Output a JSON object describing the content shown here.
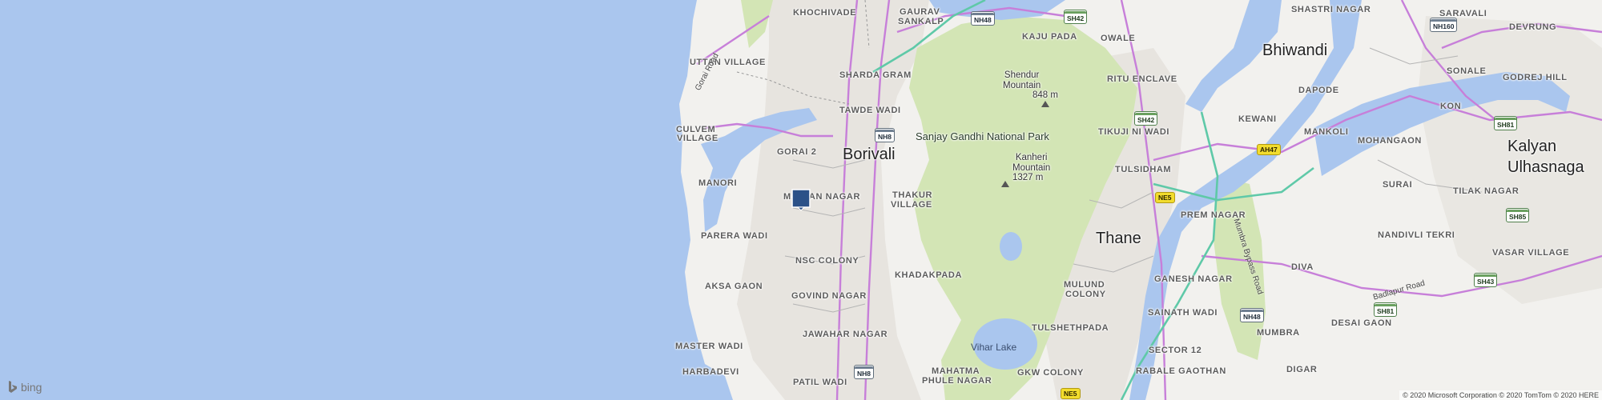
{
  "map": {
    "attribution": "© 2020 Microsoft Corporation © 2020 TomTom © 2020 HERE",
    "logo_text": "bing",
    "colors": {
      "water": "#aac6ee",
      "land": "#f2f1ee",
      "urban": "#e6e4df",
      "park": "#d3e5b5",
      "primary_road": "#c77fd9",
      "highway": "#5fc9a8"
    },
    "cities": {
      "borivali": "Borivali",
      "thane": "Thane",
      "bhiwandi": "Bhiwandi",
      "kalyan": "Kalyan",
      "ulhasnagar": "Ulhasnaga"
    },
    "park": "Sanjay Gandhi National Park",
    "peaks": {
      "shendur_name": "Shendur\nMountain",
      "shendur_elev": "848 m",
      "kanheri_name": "Kanheri\nMountain",
      "kanheri_elev": "1327 m"
    },
    "water_body": "Vihar Lake",
    "neighborhoods": {
      "khochivade": "KHOCHIVADE",
      "gaurav_sankalp_1": "GAURAV",
      "gaurav_sankalp_2": "SANKALP",
      "kaju_pada": "KAJU PADA",
      "owale": "OWALE",
      "shastri_nagar": "SHASTRI NAGAR",
      "saravali": "SARAVALI",
      "devrung": "DEVRUNG",
      "uttan_village": "UTTAN VILLAGE",
      "sharda_gram": "SHARDA GRAM",
      "ritu_enclave": "RITU ENCLAVE",
      "dapode": "DAPODE",
      "sonale": "SONALE",
      "godrej_hill": "GODREJ HILL",
      "tawde_wadi": "TAWDE WADI",
      "kon": "KON",
      "kewani": "KEWANI",
      "culvem_village_1": "CULVEM",
      "culvem_village_2": "VILLAGE",
      "gorai_2": "GORAI 2",
      "tikuji_ni_wadi": "TIKUJI NI WADI",
      "mankoli": "MANKOLI",
      "mohangaon": "MOHANGAON",
      "tulsidham": "TULSIDHAM",
      "manori": "MANORI",
      "malvani_nagar": "MALVAN NAGAR",
      "thakur_village_1": "THAKUR",
      "thakur_village_2": "VILLAGE",
      "prem_nagar": "PREM NAGAR",
      "surai": "SURAI",
      "tilak_nagar": "TILAK NAGAR",
      "parera_wadi": "PARERA WADI",
      "nandivli_tekri": "NANDIVLI TEKRI",
      "nsc_colony": "NSC COLONY",
      "vasar_village": "VASAR VILLAGE",
      "khadakpada": "KHADAKPADA",
      "ganesh_nagar": "GANESH NAGAR",
      "diva": "DIVA",
      "aksa_gaon": "AKSA GAON",
      "mulund_colony_1": "MULUND",
      "mulund_colony_2": "COLONY",
      "govind_nagar": "GOVIND NAGAR",
      "sainath_wadi": "SAINATH WADI",
      "desai_gaon": "DESAI GAON",
      "tulshethpada": "TULSHETHPADA",
      "jawahar_nagar": "JAWAHAR NAGAR",
      "mumbra": "MUMBRA",
      "master_wadi": "MASTER WADI",
      "sector_12": "SECTOR 12",
      "harbadevi": "HARBADEVI",
      "mahatma_phule_1": "MAHATMA",
      "mahatma_phule_2": "PHULE NAGAR",
      "gkw_colony": "GKW COLONY",
      "rabale_gaothan": "RABALE GAOTHAN",
      "digar": "DIGAR",
      "patil_wadi": "PATIL WADI"
    },
    "road_names": {
      "gorai_road": "Gorai Road",
      "mumbra_bypass": "Mumbra Bypass Road",
      "badlapur_road": "Badlapur Road"
    },
    "shields": {
      "nh48_top": "NH48",
      "sh42_top": "SH42",
      "nh160": "NH160",
      "nh8_borivali": "NH8",
      "sh42_mid": "SH42",
      "sh81_right": "SH81",
      "ah47": "AH47",
      "ne5_mid": "NE5",
      "sh85": "SH85",
      "sh43": "SH43",
      "sh81_bottom": "SH81",
      "nh48_bottom": "NH48",
      "nh8_bottom": "NH8",
      "ne5_bottom": "NE5"
    },
    "marker": {
      "name": "location-pin",
      "color": "#2b5188"
    }
  }
}
